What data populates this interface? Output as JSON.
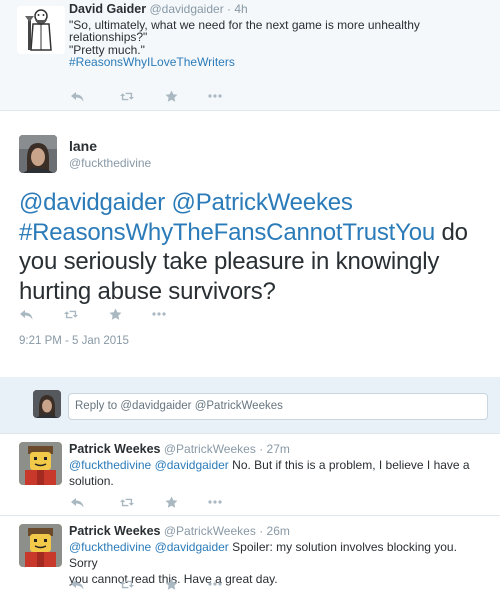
{
  "top_tweet": {
    "name": "David Gaider",
    "handle": "@davidgaider",
    "time": "· 4h",
    "lines": [
      "\"So, ultimately, what we need for the next game is more unhealthy",
      "relationships?\"",
      "\"Pretty much.\""
    ],
    "hashtag": "#ReasonsWhyILoveTheWriters"
  },
  "main_tweet": {
    "name": "lane",
    "handle": "@fuckthedivine",
    "mention1": "@davidgaider",
    "mention2": "@PatrickWeekes",
    "hashtag": "#ReasonsWhyTheFansCannotTrustYou",
    "text_after_hashtag": " do",
    "text_line3": "you seriously take pleasure in knowingly",
    "text_line4": "hurting abuse survivors?",
    "timestamp": "9:21 PM - 5 Jan 2015"
  },
  "reply_box": {
    "placeholder": "Reply to @davidgaider @PatrickWeekes"
  },
  "replies": [
    {
      "name": "Patrick Weekes",
      "handle": "@PatrickWeekes",
      "time": "· 27m",
      "mention1": "@fuckthedivine",
      "mention2": "@davidgaider",
      "text_line1": "No. But if this is a problem, I believe I have a",
      "text_line2": "solution."
    },
    {
      "name": "Patrick Weekes",
      "handle": "@PatrickWeekes",
      "time": "· 26m",
      "mention1": "@fuckthedivine",
      "mention2": "@davidgaider",
      "text_line1": "Spoiler: my solution involves blocking you. Sorry",
      "text_line2": "you cannot read this. Have a great day."
    }
  ],
  "icons": {
    "reply": "reply-icon",
    "retweet": "retweet-icon",
    "favorite": "star-icon",
    "more": "more-icon"
  },
  "colors": {
    "link": "#2b7bb9",
    "muted": "#8899a6",
    "action": "#aab8c2",
    "text": "#292f33",
    "reply_box_bg": "#e8f1f8"
  }
}
